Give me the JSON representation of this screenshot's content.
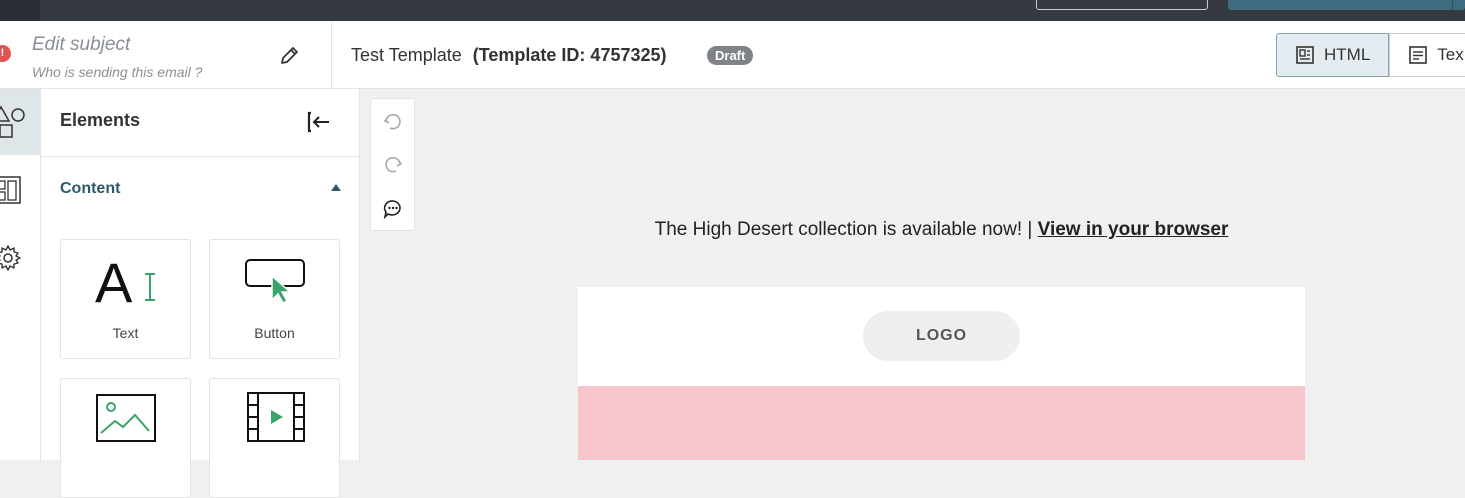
{
  "header": {
    "subject_placeholder": "Edit subject",
    "sender_placeholder": "Who is sending this email ?",
    "error_badge": "!",
    "template_name": "Test Template",
    "template_id": "(Template ID: 4757325)",
    "status_badge": "Draft",
    "format_tabs": [
      {
        "label": "HTML",
        "active": true
      },
      {
        "label": "Tex",
        "active": false
      }
    ]
  },
  "sidebar": {
    "rail": [
      "shapes-icon",
      "layout-icon",
      "gear-icon"
    ],
    "panel_title": "Elements",
    "section_label": "Content",
    "tiles": [
      {
        "label": "Text",
        "icon": "text-element-icon"
      },
      {
        "label": "Button",
        "icon": "button-element-icon"
      },
      {
        "label": "",
        "icon": "image-element-icon"
      },
      {
        "label": "",
        "icon": "video-element-icon"
      }
    ]
  },
  "canvas": {
    "preheader_text": "The High Desert collection is available now! |",
    "preheader_link": "View in your browser",
    "logo_text": "LOGO"
  },
  "colors": {
    "topbar": "#353a42",
    "accent": "#3f6b80",
    "text_green": "#3aa36a",
    "hero_pink": "#f6c6cc",
    "draft_badge": "#7f8287",
    "error": "#e05454"
  }
}
